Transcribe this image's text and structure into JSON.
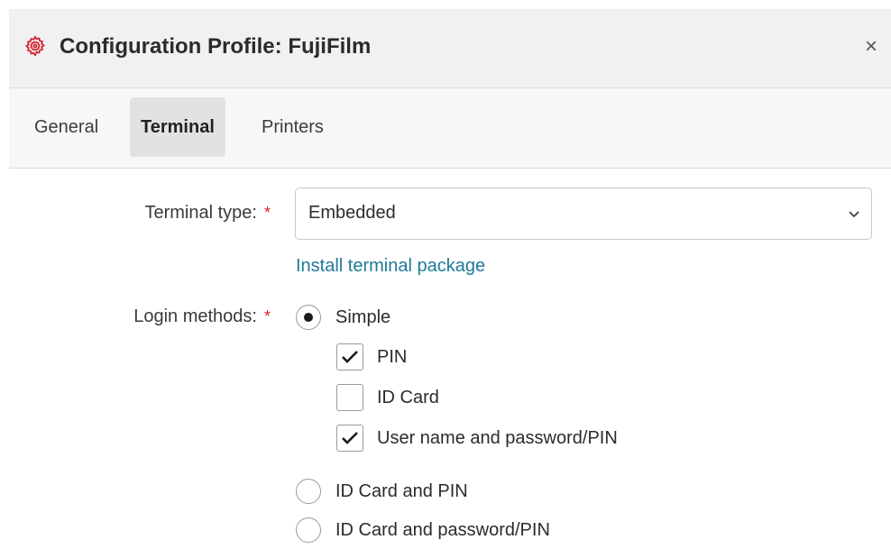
{
  "dialog": {
    "title": "Configuration Profile: FujiFilm",
    "icon": "gear-icon",
    "close_label": "×",
    "accent_color": "#d9232e"
  },
  "tabs": [
    {
      "label": "General",
      "active": false
    },
    {
      "label": "Terminal",
      "active": true
    },
    {
      "label": "Printers",
      "active": false
    }
  ],
  "form": {
    "terminal_type": {
      "label": "Terminal type:",
      "required_mark": "*",
      "value": "Embedded"
    },
    "install_link": "Install terminal package",
    "login_methods": {
      "label": "Login methods:",
      "required_mark": "*",
      "options": [
        {
          "label": "Simple",
          "selected": true
        },
        {
          "label": "ID Card and PIN",
          "selected": false
        },
        {
          "label": "ID Card and password/PIN",
          "selected": false
        }
      ],
      "simple_suboptions": [
        {
          "label": "PIN",
          "checked": true
        },
        {
          "label": "ID Card",
          "checked": false
        },
        {
          "label": "User name and password/PIN",
          "checked": true
        }
      ]
    }
  }
}
